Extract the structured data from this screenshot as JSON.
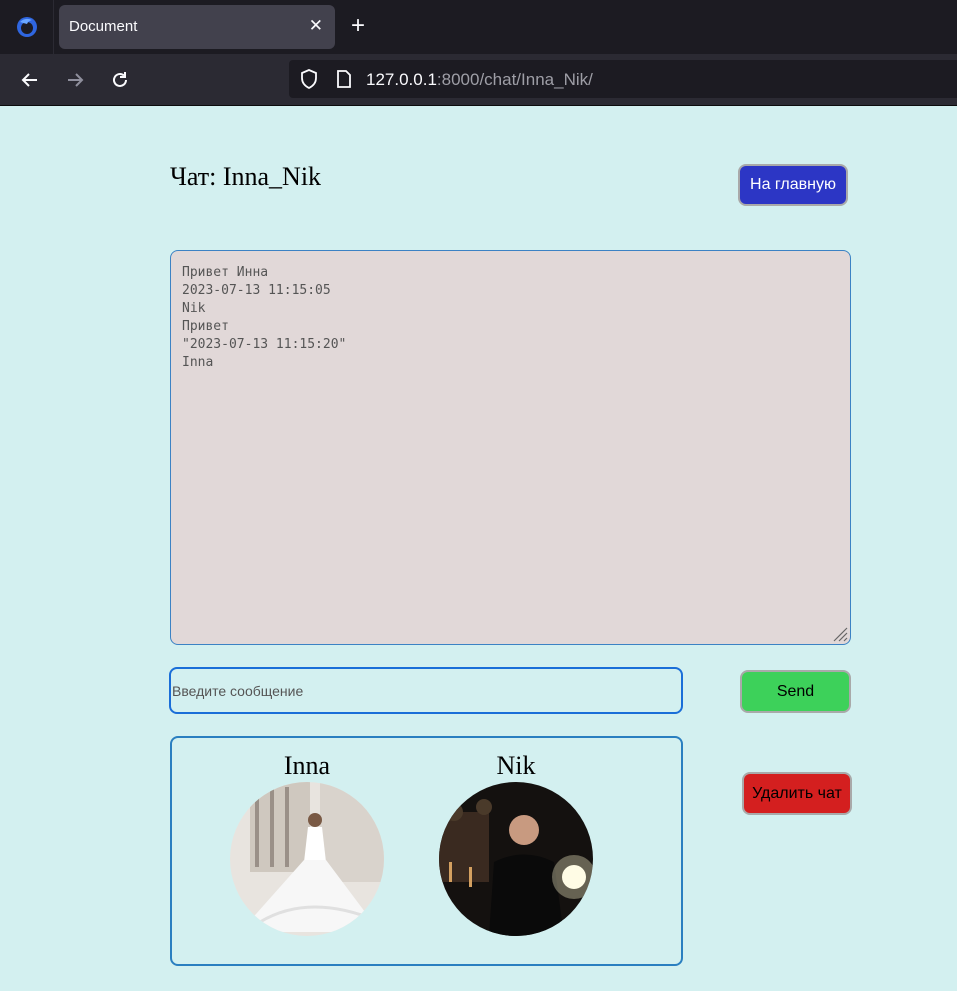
{
  "browser": {
    "tab_title": "Document",
    "tab_close_glyph": "✕",
    "new_tab_glyph": "+",
    "url_host": "127.0.0.1",
    "url_rest": ":8000/chat/Inna_Nik/"
  },
  "page": {
    "title": "Чат: Inna_Nik",
    "home_button": "На главную",
    "chat_log": "Привет Инна\n2023-07-13 11:15:05\nNik\nПривет\n\"2023-07-13 11:15:20\"\nInna",
    "message_placeholder": "Введите сообщение",
    "send_button": "Send",
    "delete_button": "Удалить чат"
  },
  "members": [
    {
      "name": "Inna",
      "avatar": "bride-in-white-dress-photo"
    },
    {
      "name": "Nik",
      "avatar": "man-at-night-city-photo"
    }
  ],
  "colors": {
    "page_bg": "#d3f0f0",
    "home_button": "#2c36c5",
    "send_button": "#3dd15a",
    "delete_button": "#d41f1f",
    "chat_log_bg": "#e1d8d8"
  }
}
